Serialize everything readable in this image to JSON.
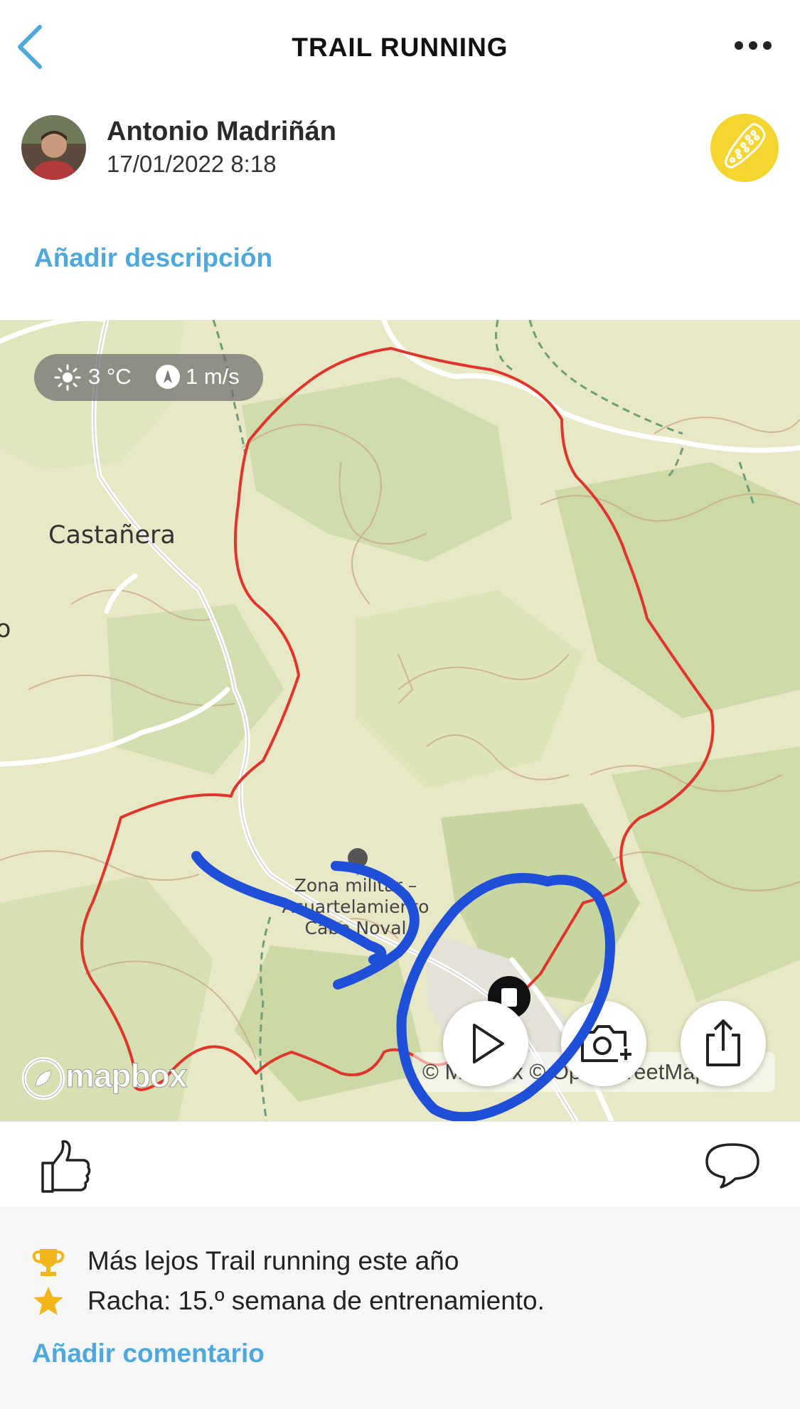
{
  "header": {
    "title": "TRAIL RUNNING",
    "back_icon": "chevron-left-icon",
    "more_icon": "ellipsis-icon"
  },
  "user": {
    "name": "Antonio Madriñán",
    "date": "17/01/2022 8:18",
    "sport_icon": "trail-running-shoe-icon",
    "sport_color": "#f5d52f"
  },
  "description": {
    "add_label": "Añadir descripción"
  },
  "map": {
    "weather": {
      "temperature": "3 °C",
      "wind_speed": "1 m/s"
    },
    "places": {
      "castanera": "Castañera",
      "partial": "o",
      "zona": "Zona militar – Acuartelamiento Cabo Noval"
    },
    "logo_text": "mapbox",
    "attribution": "© Mapbox © OpenStreetMap",
    "route_color": "#e0352b",
    "buttons": {
      "play": "play-icon",
      "camera": "add-photo-icon",
      "share": "share-icon"
    }
  },
  "actions": {
    "like_icon": "thumbs-up-icon",
    "comment_icon": "comment-bubble-icon"
  },
  "achievements": [
    {
      "icon": "trophy-icon",
      "text": "Más lejos Trail running este año"
    },
    {
      "icon": "star-icon",
      "text": "Racha: 15.º semana de entrenamiento."
    }
  ],
  "comments": {
    "add_label": "Añadir comentario"
  },
  "colors": {
    "accent_blue": "#4ea8dc",
    "annotation_blue": "#1f4fd8",
    "gold": "#f2b51b"
  }
}
